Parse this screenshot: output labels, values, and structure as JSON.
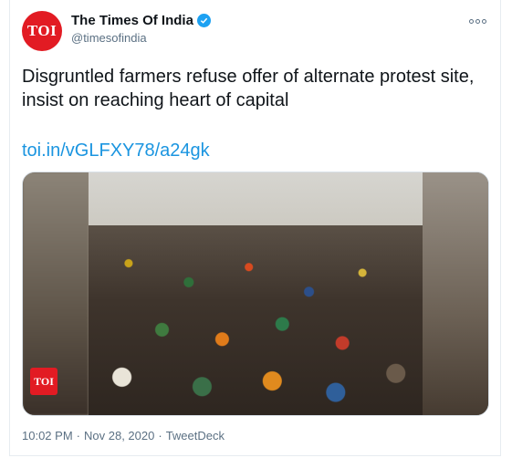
{
  "account": {
    "avatar_text": "TOI",
    "display_name": "The Times Of India",
    "handle": "@timesofindia",
    "verified_icon": "verified-badge-icon"
  },
  "tweet": {
    "text": "Disgruntled farmers refuse offer of alternate protest site, insist on reaching heart of capital",
    "link": "toi.in/vGLFXY78/a24gk",
    "media_badge": "TOI"
  },
  "meta": {
    "time": "10:02 PM",
    "sep1": "·",
    "date": "Nov 28, 2020",
    "sep2": "·",
    "source": "TweetDeck"
  },
  "colors": {
    "link": "#1b95e0",
    "brand": "#e21b23",
    "verified": "#1da1f2",
    "muted": "#5b7083"
  }
}
